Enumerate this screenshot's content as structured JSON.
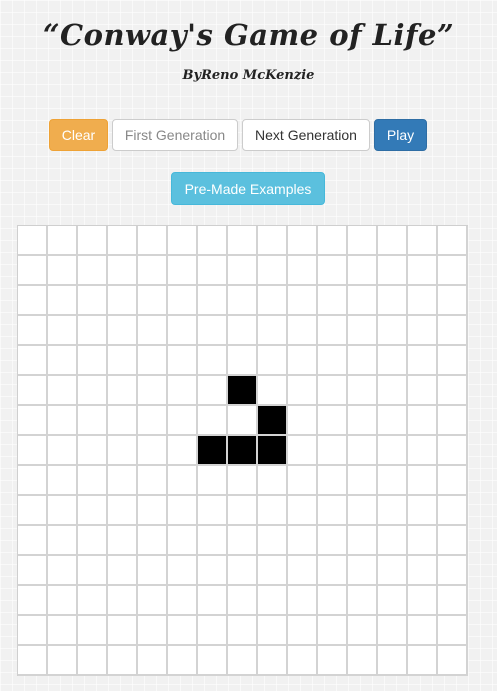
{
  "header": {
    "title": "“Conway's Game of Life”",
    "subtitle": "ByReno McKenzie"
  },
  "controls": {
    "clear_label": "Clear",
    "first_generation_label": "First Generation",
    "next_generation_label": "Next Generation",
    "play_label": "Play",
    "examples_label": "Pre-Made Examples"
  },
  "colors": {
    "clear": "#f0ad4e",
    "play": "#337ab7",
    "examples": "#5bc0de",
    "alive_cell": "#000000",
    "dead_cell": "#ffffff",
    "grid_line": "#d3d3d3"
  },
  "board": {
    "rows": 15,
    "cols": 15,
    "alive_cells": [
      [
        5,
        7
      ],
      [
        6,
        8
      ],
      [
        7,
        6
      ],
      [
        7,
        7
      ],
      [
        7,
        8
      ]
    ]
  }
}
